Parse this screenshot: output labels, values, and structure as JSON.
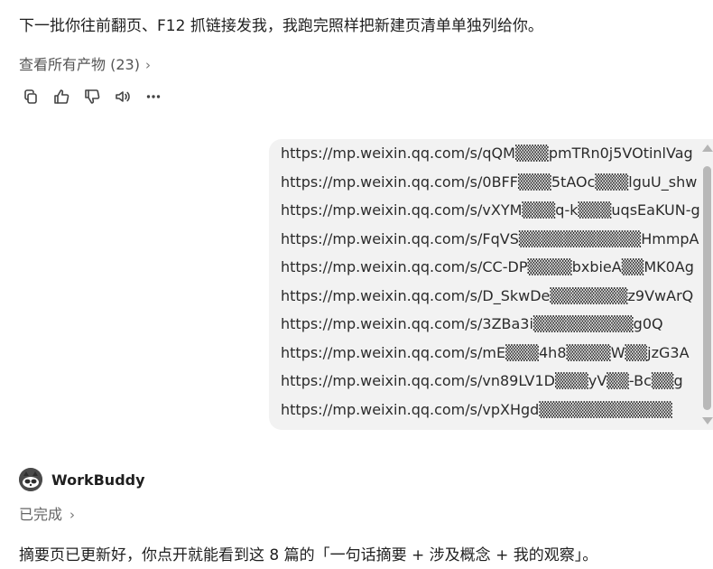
{
  "user_message": {
    "text": "下一批你往前翻页、F12 抓链接发我，我跑完照样把新建页清单单独列给你。",
    "artifacts_label": "查看所有产物 (23)",
    "artifacts_chevron": "›",
    "actions": [
      {
        "icon": "copy-icon",
        "label": "copy"
      },
      {
        "icon": "thumbs-up-icon",
        "label": "like"
      },
      {
        "icon": "thumbs-down-icon",
        "label": "dislike"
      },
      {
        "icon": "speaker-icon",
        "label": "read aloud"
      },
      {
        "icon": "more-icon",
        "label": "more"
      }
    ]
  },
  "links_bubble": {
    "links": [
      "https://mp.weixin.qq.com/s/qQM▒▒▒pmTRn0j5VOtinlVag",
      "https://mp.weixin.qq.com/s/0BFF▒▒▒5tAOc▒▒▒lguU_shw",
      "https://mp.weixin.qq.com/s/vXYM▒▒▒q-k▒▒▒uqsEaKUN-g",
      "https://mp.weixin.qq.com/s/FqVS▒▒▒▒▒▒▒▒▒▒▒HmmpA",
      "https://mp.weixin.qq.com/s/CC-DP▒▒▒▒bxbieA▒▒MK0Ag",
      "https://mp.weixin.qq.com/s/D_SkwDe▒▒▒▒▒▒▒z9VwArQ",
      "https://mp.weixin.qq.com/s/3ZBa3i▒▒▒▒▒▒▒▒▒g0Q",
      "https://mp.weixin.qq.com/s/mE▒▒▒4h8▒▒▒▒W▒▒jzG3A",
      "https://mp.weixin.qq.com/s/vn89LV1D▒▒▒yV▒▒-Bc▒▒g",
      "https://mp.weixin.qq.com/s/vpXHgd▒▒▒▒▒▒▒▒▒▒▒▒"
    ]
  },
  "bot_message": {
    "name": "WorkBuddy",
    "avatar_icon": "raccoon-avatar-icon",
    "status_label": "已完成",
    "status_chevron": "›",
    "reply_text": "摘要页已更新好，你点开就能看到这 8 篇的「一句话摘要 + 涉及概念 + 我的观察」。"
  },
  "colors": {
    "background": "#ffffff",
    "bubble": "#f2f2f2",
    "text": "#1f1f1f",
    "muted": "#666666",
    "scrollbar": "#b8b8b8"
  }
}
